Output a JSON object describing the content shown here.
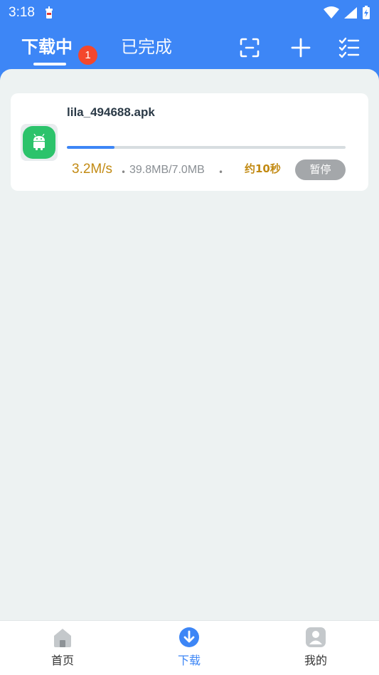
{
  "status_bar": {
    "time": "3:18"
  },
  "header": {
    "tabs": [
      {
        "label": "下载中",
        "active": true,
        "badge": "1"
      },
      {
        "label": "已完成",
        "active": false
      }
    ],
    "actions": [
      "scan-icon",
      "add-icon",
      "checklist-icon"
    ]
  },
  "downloads": [
    {
      "file_name": "lila_494688.apk",
      "progress": 0.17,
      "speed": "3.2M/s",
      "size": "39.8MB/7.0MB",
      "eta": "约10秒",
      "action_label": "暂停"
    }
  ],
  "bottom_nav": {
    "items": [
      {
        "label": "首页",
        "icon": "home-icon",
        "active": false
      },
      {
        "label": "下载",
        "icon": "download-icon",
        "active": true
      },
      {
        "label": "我的",
        "icon": "profile-icon",
        "active": false
      }
    ]
  },
  "colors": {
    "primary": "#3d86f6",
    "badge": "#f4472c",
    "accent_text": "#c28a13",
    "app_icon_bg": "#2cc36b"
  }
}
